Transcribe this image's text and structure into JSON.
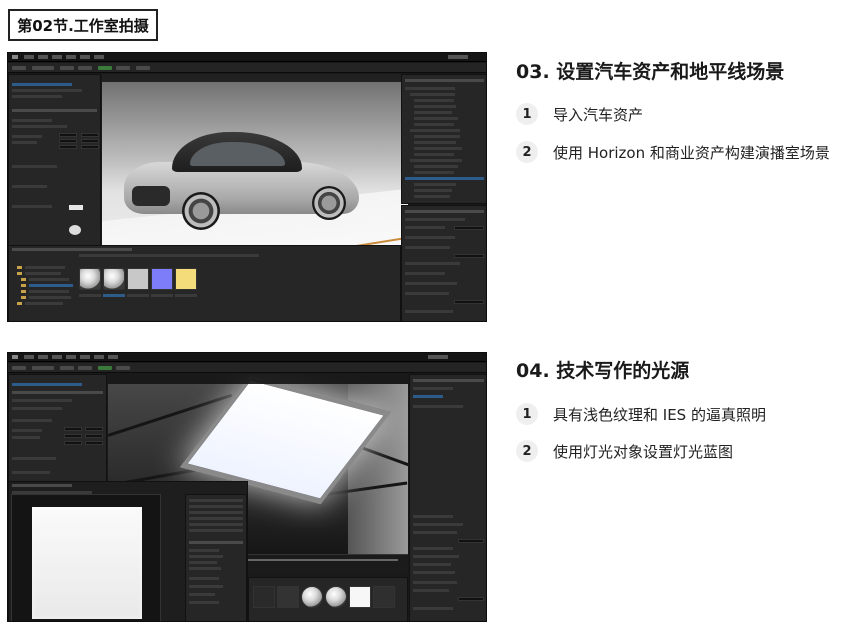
{
  "section": {
    "label": "第02节.工作室拍摄"
  },
  "blocks": [
    {
      "title": "03. 设置汽车资产和地平线场景",
      "items": [
        {
          "number": "1",
          "text": "导入汽车资产"
        },
        {
          "number": "2",
          "text": "使用 Horizon 和商业资产构建演播室场景"
        }
      ]
    },
    {
      "title": "04. 技术写作的光源",
      "items": [
        {
          "number": "1",
          "text": "具有浅色纹理和 IES 的逼真照明"
        },
        {
          "number": "2",
          "text": "使用灯光对象设置灯光蓝图"
        }
      ]
    }
  ],
  "colors": {
    "editor_bg": "#1a1a1a",
    "panel_bg": "#262626",
    "selection": "#2e5c8a",
    "number_badge_bg": "#efefef",
    "heading_text": "#1a1a1a"
  },
  "icons": [
    "ue-logo-icon",
    "folder-icon",
    "material-sphere-icon"
  ]
}
